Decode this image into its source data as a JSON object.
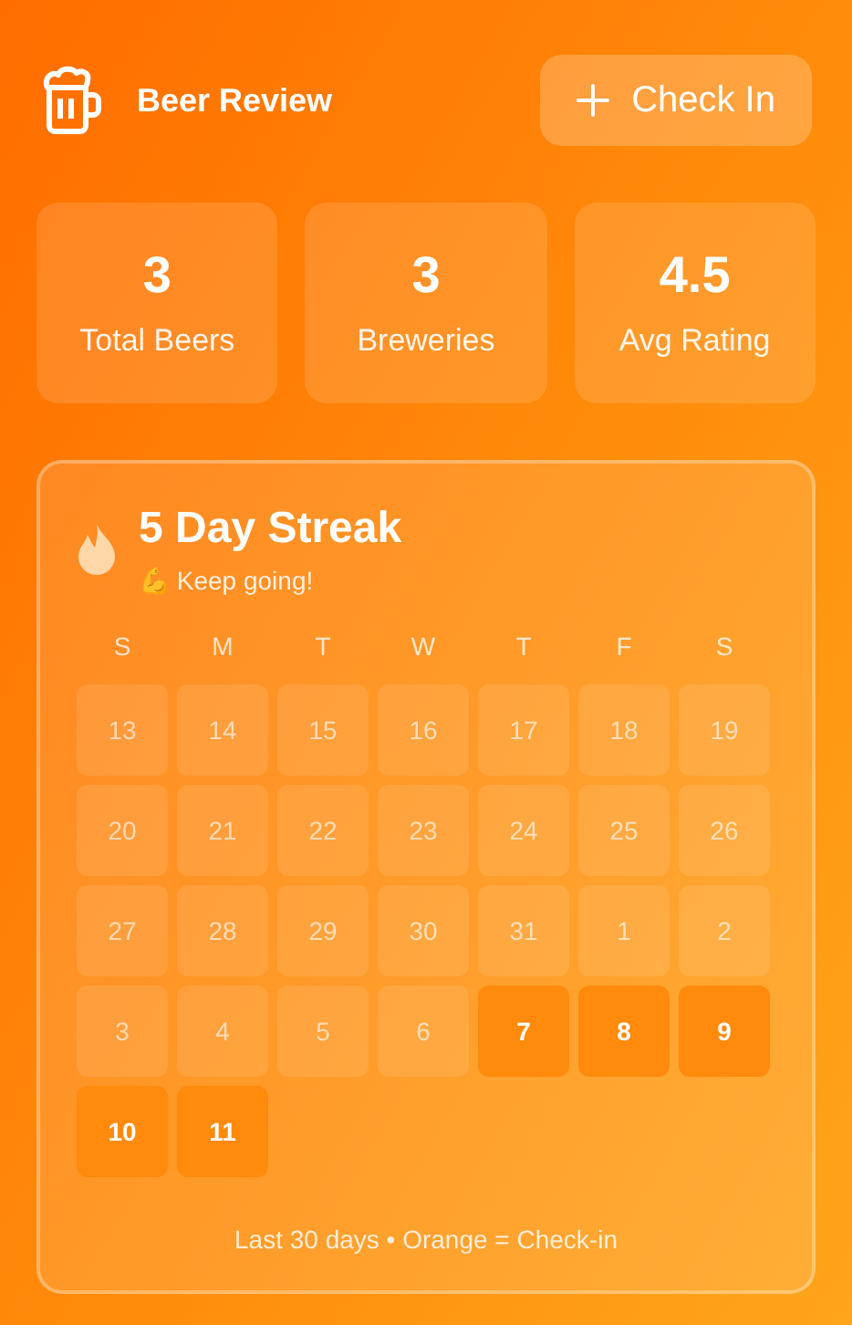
{
  "header": {
    "title": "Beer Review",
    "button": "Check In"
  },
  "stats": [
    {
      "value": "3",
      "label": "Total Beers"
    },
    {
      "value": "3",
      "label": "Breweries"
    },
    {
      "value": "4.5",
      "label": "Avg Rating"
    }
  ],
  "streak": {
    "title": "5 Day Streak",
    "subtitle": "💪 Keep going!",
    "weekdays": [
      "S",
      "M",
      "T",
      "W",
      "T",
      "F",
      "S"
    ],
    "days": [
      {
        "label": "13",
        "checked": false
      },
      {
        "label": "14",
        "checked": false
      },
      {
        "label": "15",
        "checked": false
      },
      {
        "label": "16",
        "checked": false
      },
      {
        "label": "17",
        "checked": false
      },
      {
        "label": "18",
        "checked": false
      },
      {
        "label": "19",
        "checked": false
      },
      {
        "label": "20",
        "checked": false
      },
      {
        "label": "21",
        "checked": false
      },
      {
        "label": "22",
        "checked": false
      },
      {
        "label": "23",
        "checked": false
      },
      {
        "label": "24",
        "checked": false
      },
      {
        "label": "25",
        "checked": false
      },
      {
        "label": "26",
        "checked": false
      },
      {
        "label": "27",
        "checked": false
      },
      {
        "label": "28",
        "checked": false
      },
      {
        "label": "29",
        "checked": false
      },
      {
        "label": "30",
        "checked": false
      },
      {
        "label": "31",
        "checked": false
      },
      {
        "label": "1",
        "checked": false
      },
      {
        "label": "2",
        "checked": false
      },
      {
        "label": "3",
        "checked": false
      },
      {
        "label": "4",
        "checked": false
      },
      {
        "label": "5",
        "checked": false
      },
      {
        "label": "6",
        "checked": false
      },
      {
        "label": "7",
        "checked": true
      },
      {
        "label": "8",
        "checked": true
      },
      {
        "label": "9",
        "checked": true
      },
      {
        "label": "10",
        "checked": true
      },
      {
        "label": "11",
        "checked": true
      }
    ],
    "legend": "Last 30 days • Orange = Check-in"
  }
}
